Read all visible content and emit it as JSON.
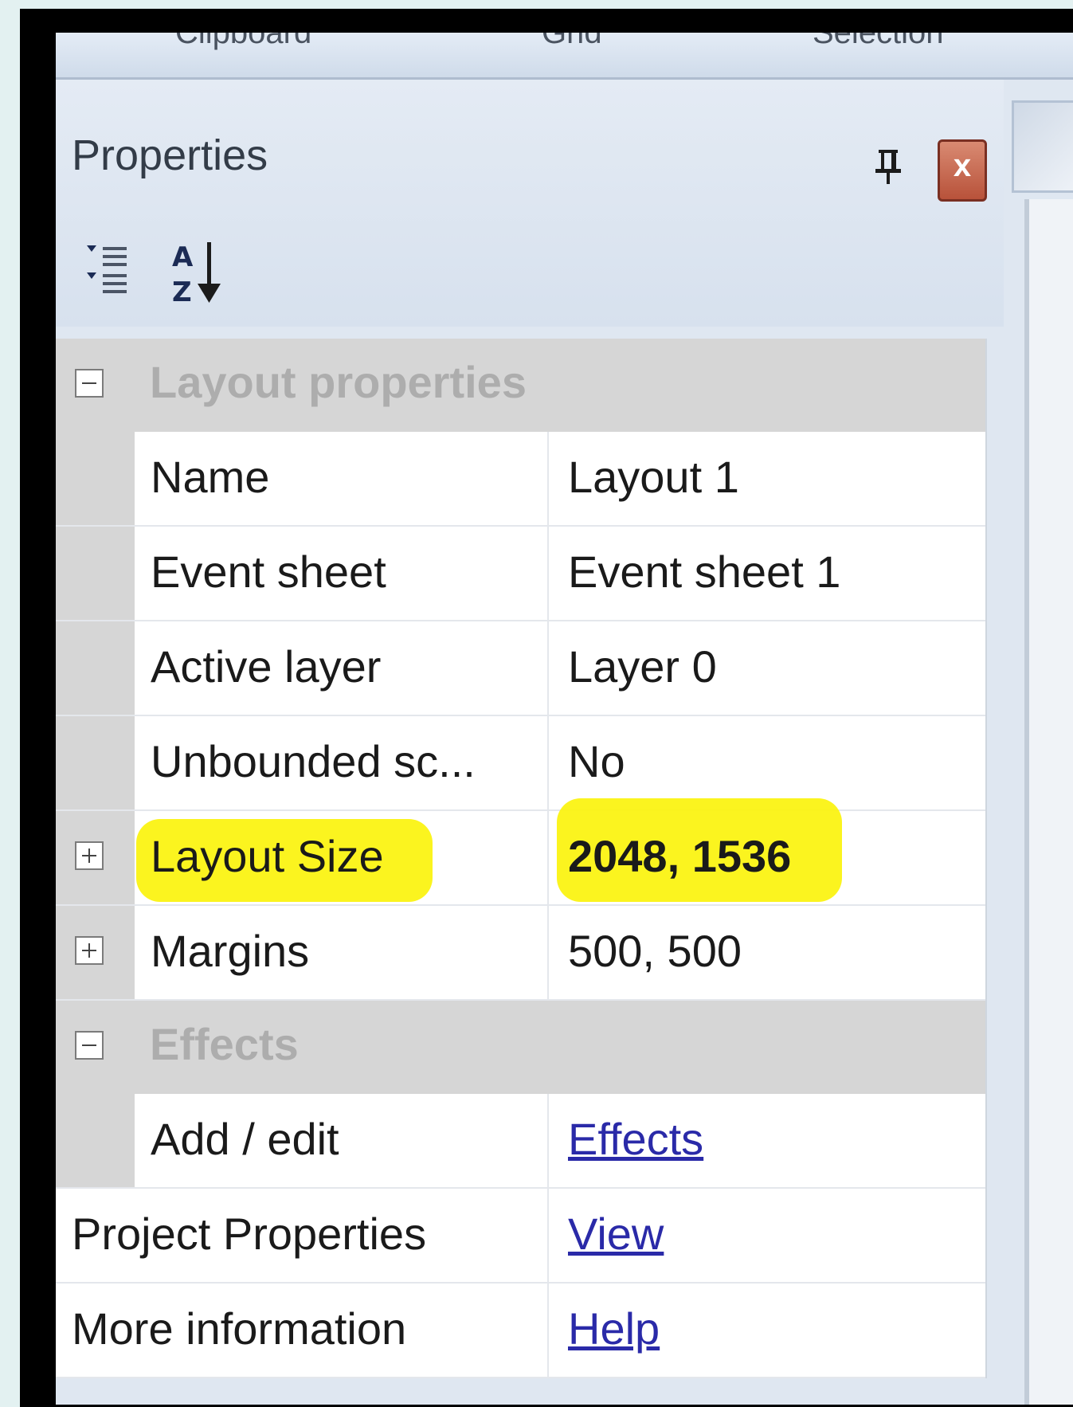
{
  "ribbon": {
    "labels": [
      "Clipboard",
      "Grid",
      "Selection"
    ]
  },
  "panel": {
    "title": "Properties",
    "pin_icon": "pin-icon",
    "close_label": "x",
    "tools": {
      "categorized": "categorized-icon",
      "alphabetical": "sort-az-icon"
    }
  },
  "grid": {
    "layout_category": "Layout properties",
    "name_label": "Name",
    "name_value": "Layout 1",
    "event_sheet_label": "Event sheet",
    "event_sheet_value": "Event sheet 1",
    "active_layer_label": "Active layer",
    "active_layer_value": "Layer 0",
    "unbounded_label": "Unbounded sc...",
    "unbounded_value": "No",
    "layout_size_label": "Layout Size",
    "layout_size_value": "2048, 1536",
    "margins_label": "Margins",
    "margins_value": "500, 500",
    "effects_category": "Effects",
    "add_edit_label": "Add / edit",
    "add_edit_value": "Effects",
    "project_props_label": "Project Properties",
    "project_props_value": "View",
    "more_info_label": "More information",
    "more_info_value": "Help"
  },
  "colors": {
    "highlight": "#fbf313",
    "link": "#2a2aa8",
    "category_background": "#d6d6d6"
  }
}
